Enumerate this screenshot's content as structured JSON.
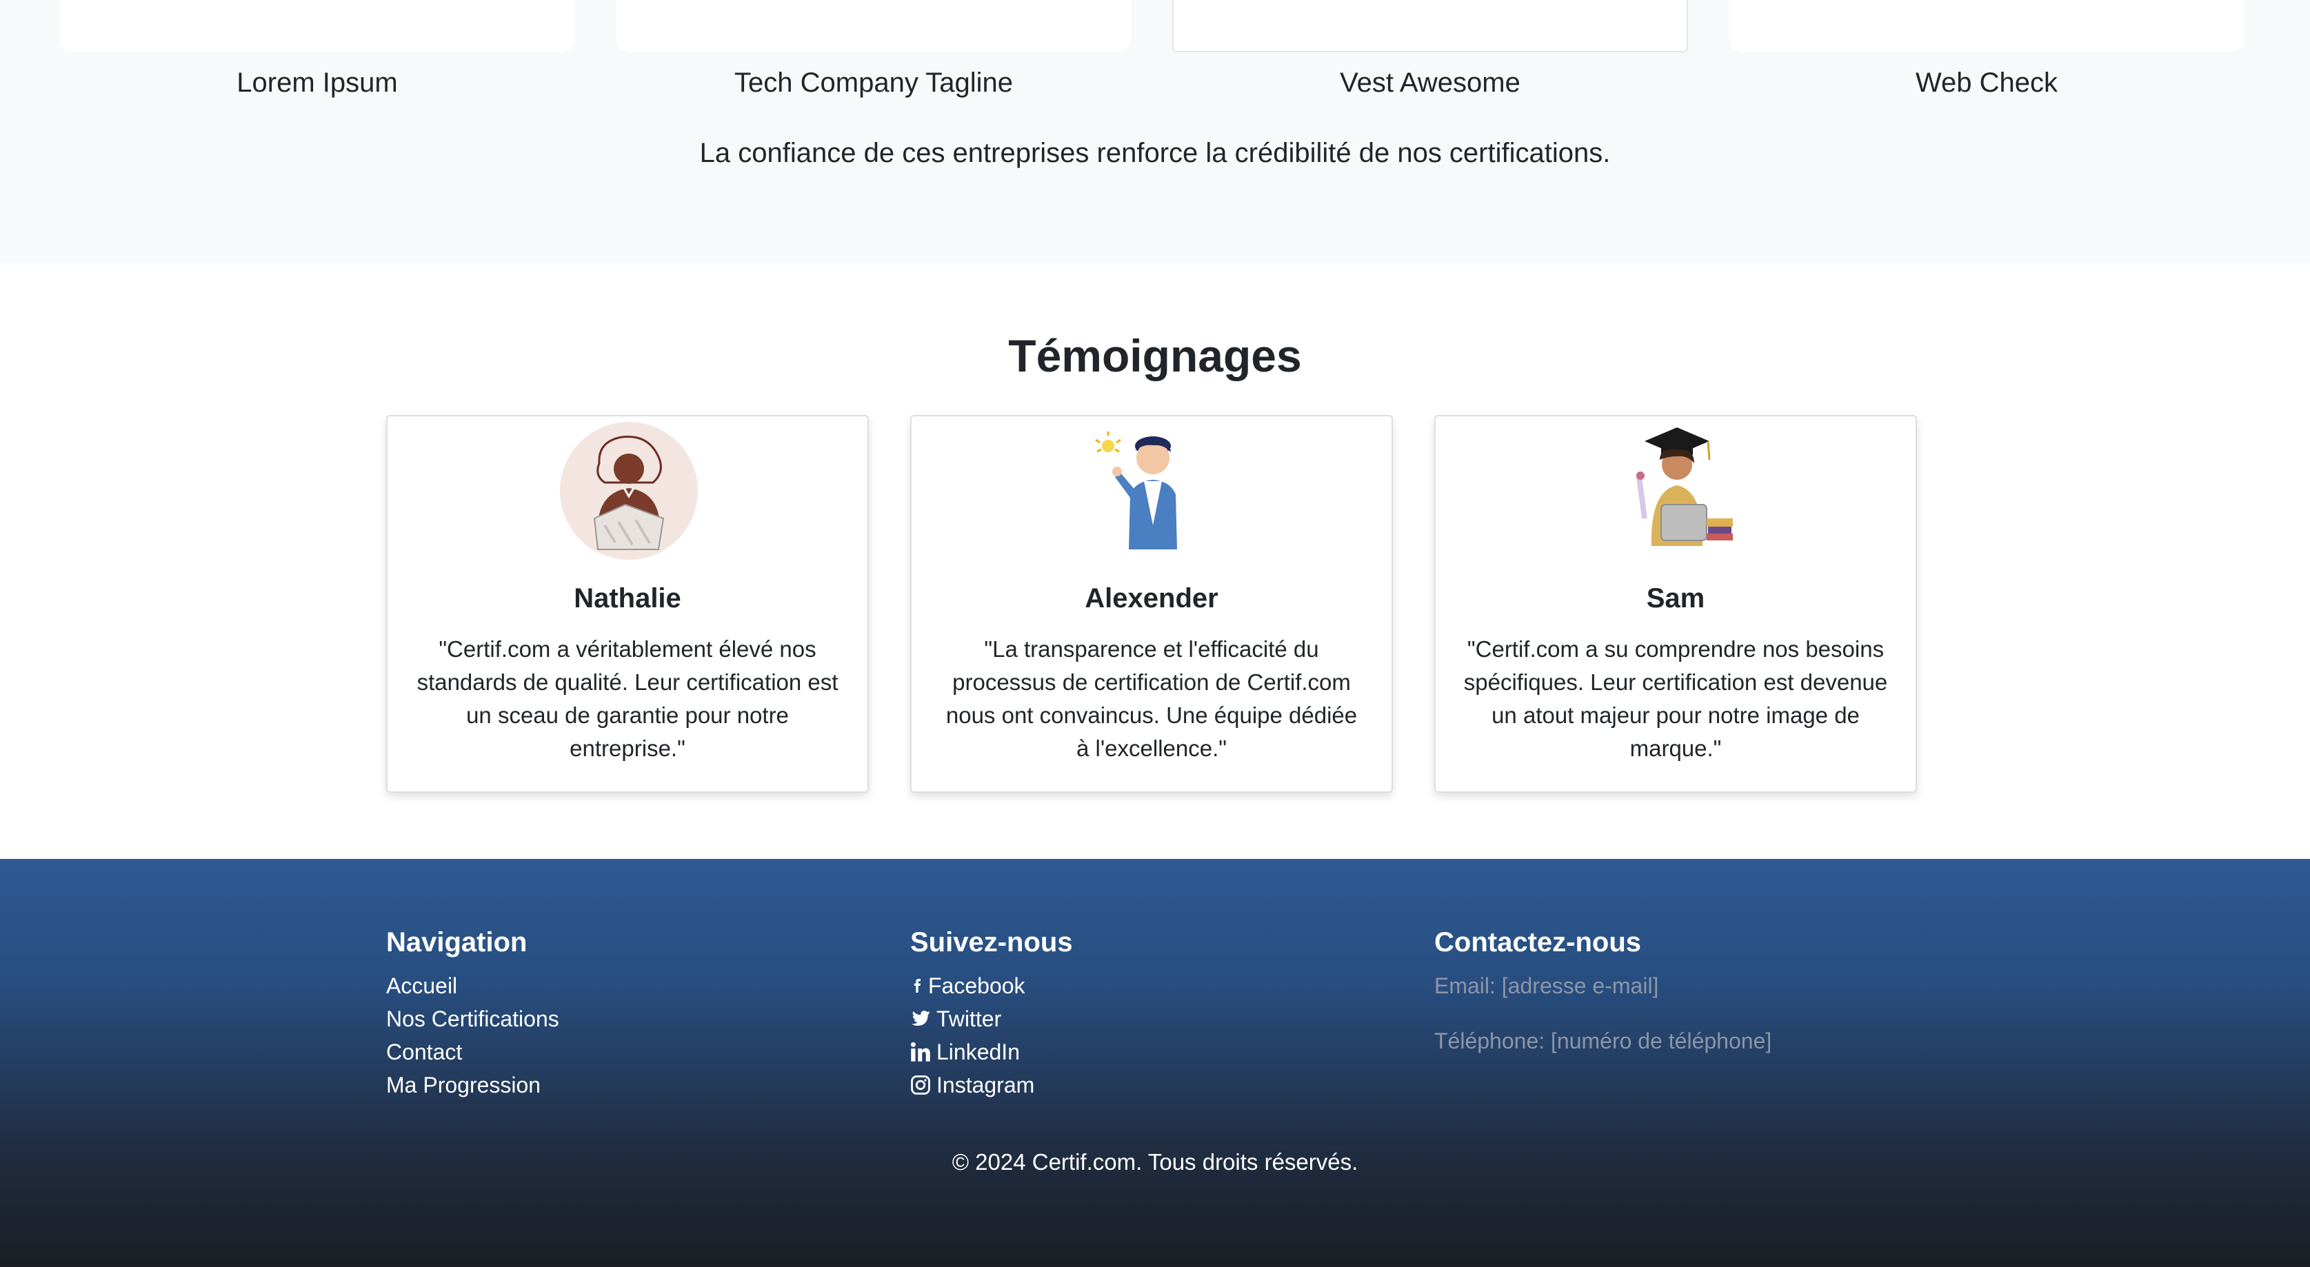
{
  "partners": {
    "names": [
      "Lorem Ipsum",
      "Tech Company Tagline",
      "Vest Awesome",
      "Web Check"
    ],
    "caption": "La confiance de ces entreprises renforce la crédibilité de nos certifications."
  },
  "testimonials": {
    "title": "Témoignages",
    "items": [
      {
        "name": "Nathalie",
        "quote": "\"Certif.com a véritablement élevé nos standards de qualité. Leur certification est un sceau de garantie pour notre entreprise.\""
      },
      {
        "name": "Alexender",
        "quote": "\"La transparence et l'efficacité du processus de certification de Certif.com nous ont convaincus. Une équipe dédiée à l'excellence.\""
      },
      {
        "name": "Sam",
        "quote": "\"Certif.com a su comprendre nos besoins spécifiques. Leur certification est devenue un atout majeur pour notre image de marque.\""
      }
    ]
  },
  "footer": {
    "navigation": {
      "title": "Navigation",
      "links": [
        "Accueil",
        "Nos Certifications",
        "Contact",
        "Ma Progression"
      ]
    },
    "social": {
      "title": "Suivez-nous",
      "links": [
        {
          "label": "Facebook",
          "icon": "facebook-icon"
        },
        {
          "label": "Twitter",
          "icon": "twitter-icon"
        },
        {
          "label": "LinkedIn",
          "icon": "linkedin-icon"
        },
        {
          "label": "Instagram",
          "icon": "instagram-icon"
        }
      ]
    },
    "contact": {
      "title": "Contactez-nous",
      "email": "Email: [adresse e-mail]",
      "phone": "Téléphone: [numéro de téléphone]"
    },
    "copyright": "© 2024 Certif.com. Tous droits réservés."
  },
  "colors": {
    "page_bg": "#ffffff",
    "partners_bg": "#f8f9fa",
    "footer_top": "#2d5a93",
    "footer_bottom": "#1b1e24",
    "muted_text": "#8c96a8"
  }
}
